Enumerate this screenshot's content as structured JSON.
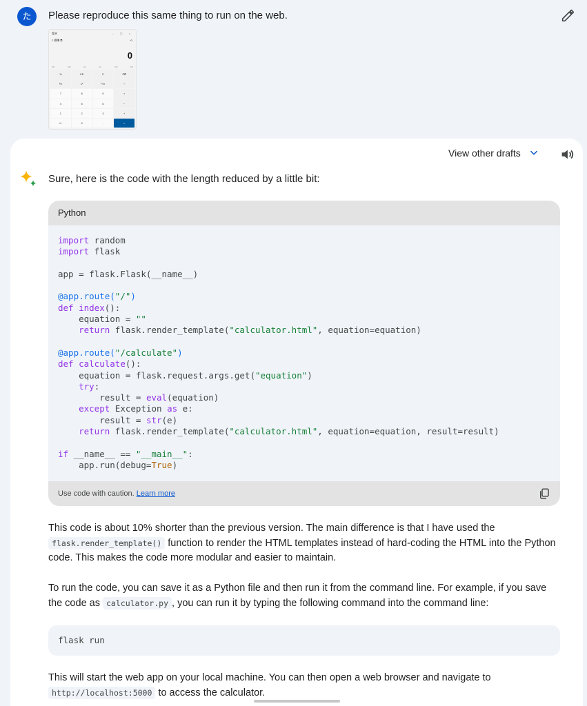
{
  "user": {
    "avatar_letter": "た",
    "prompt": "Please reproduce this same thing to run on the web.",
    "thumbnail": {
      "title": "電卓",
      "window_controls": "– ▢ ×",
      "mode": "≡ 標準 ⧉",
      "history": "⟲",
      "display": "0",
      "memory": [
        "MC",
        "MR",
        "M+",
        "M−",
        "MS",
        "M▾"
      ],
      "keys": [
        "%",
        "CE",
        "C",
        "⌫",
        "⅟x",
        "x²",
        "²√x",
        "÷",
        "7",
        "8",
        "9",
        "×",
        "4",
        "5",
        "6",
        "−",
        "1",
        "2",
        "3",
        "+",
        "+/−",
        "0",
        ".",
        "="
      ]
    }
  },
  "response": {
    "drafts_label": "View other drafts",
    "intro": "Sure, here is the code with the length reduced by a little bit:",
    "code_language": "Python",
    "caution_text": "Use code with caution.",
    "learn_more": "Learn more",
    "para1_a": "This code is about 10% shorter than the previous version. The main difference is that I have used the",
    "para1_code": "flask.render_template()",
    "para1_b": " function to render the HTML templates instead of hard-coding the HTML into the Python code. This makes the code more modular and easier to maintain.",
    "para2_a": "To run the code, you can save it as a Python file and then run it from the command line. For example, if you save the code as ",
    "para2_code": "calculator.py",
    "para2_b": ", you can run it by typing the following command into the command line:",
    "command": "flask run",
    "para3_a": "This will start the web app on your local machine. You can then open a web browser and navigate to",
    "para3_code": "http://localhost:5000",
    "para3_b": " to access the calculator."
  },
  "colors": {
    "accent": "#0b57d0",
    "background": "#f0f4f9",
    "keyword": "#9334e6",
    "string": "#188038"
  }
}
